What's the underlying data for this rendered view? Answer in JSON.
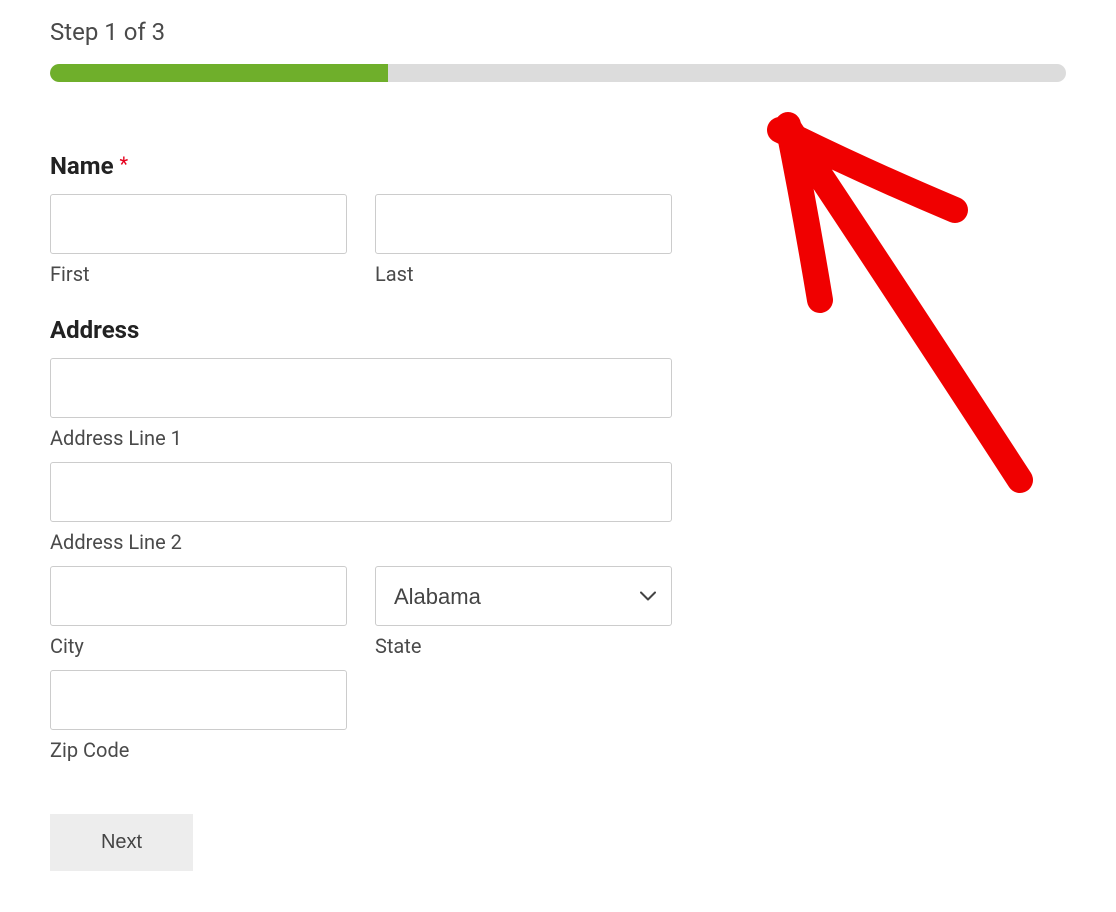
{
  "progress": {
    "step_label": "Step 1 of 3",
    "percent": 33.3
  },
  "fields": {
    "name": {
      "label": "Name",
      "required_marker": "*",
      "first": {
        "value": "",
        "sublabel": "First"
      },
      "last": {
        "value": "",
        "sublabel": "Last"
      }
    },
    "address": {
      "label": "Address",
      "line1": {
        "value": "",
        "sublabel": "Address Line 1"
      },
      "line2": {
        "value": "",
        "sublabel": "Address Line 2"
      },
      "city": {
        "value": "",
        "sublabel": "City"
      },
      "state": {
        "selected": "Alabama",
        "sublabel": "State"
      },
      "zip": {
        "value": "",
        "sublabel": "Zip Code"
      }
    }
  },
  "buttons": {
    "next": "Next"
  },
  "colors": {
    "progress_fill": "#6faf2b",
    "progress_bg": "#dcdcdc",
    "required": "#e5001c",
    "annotation": "#f00000"
  }
}
